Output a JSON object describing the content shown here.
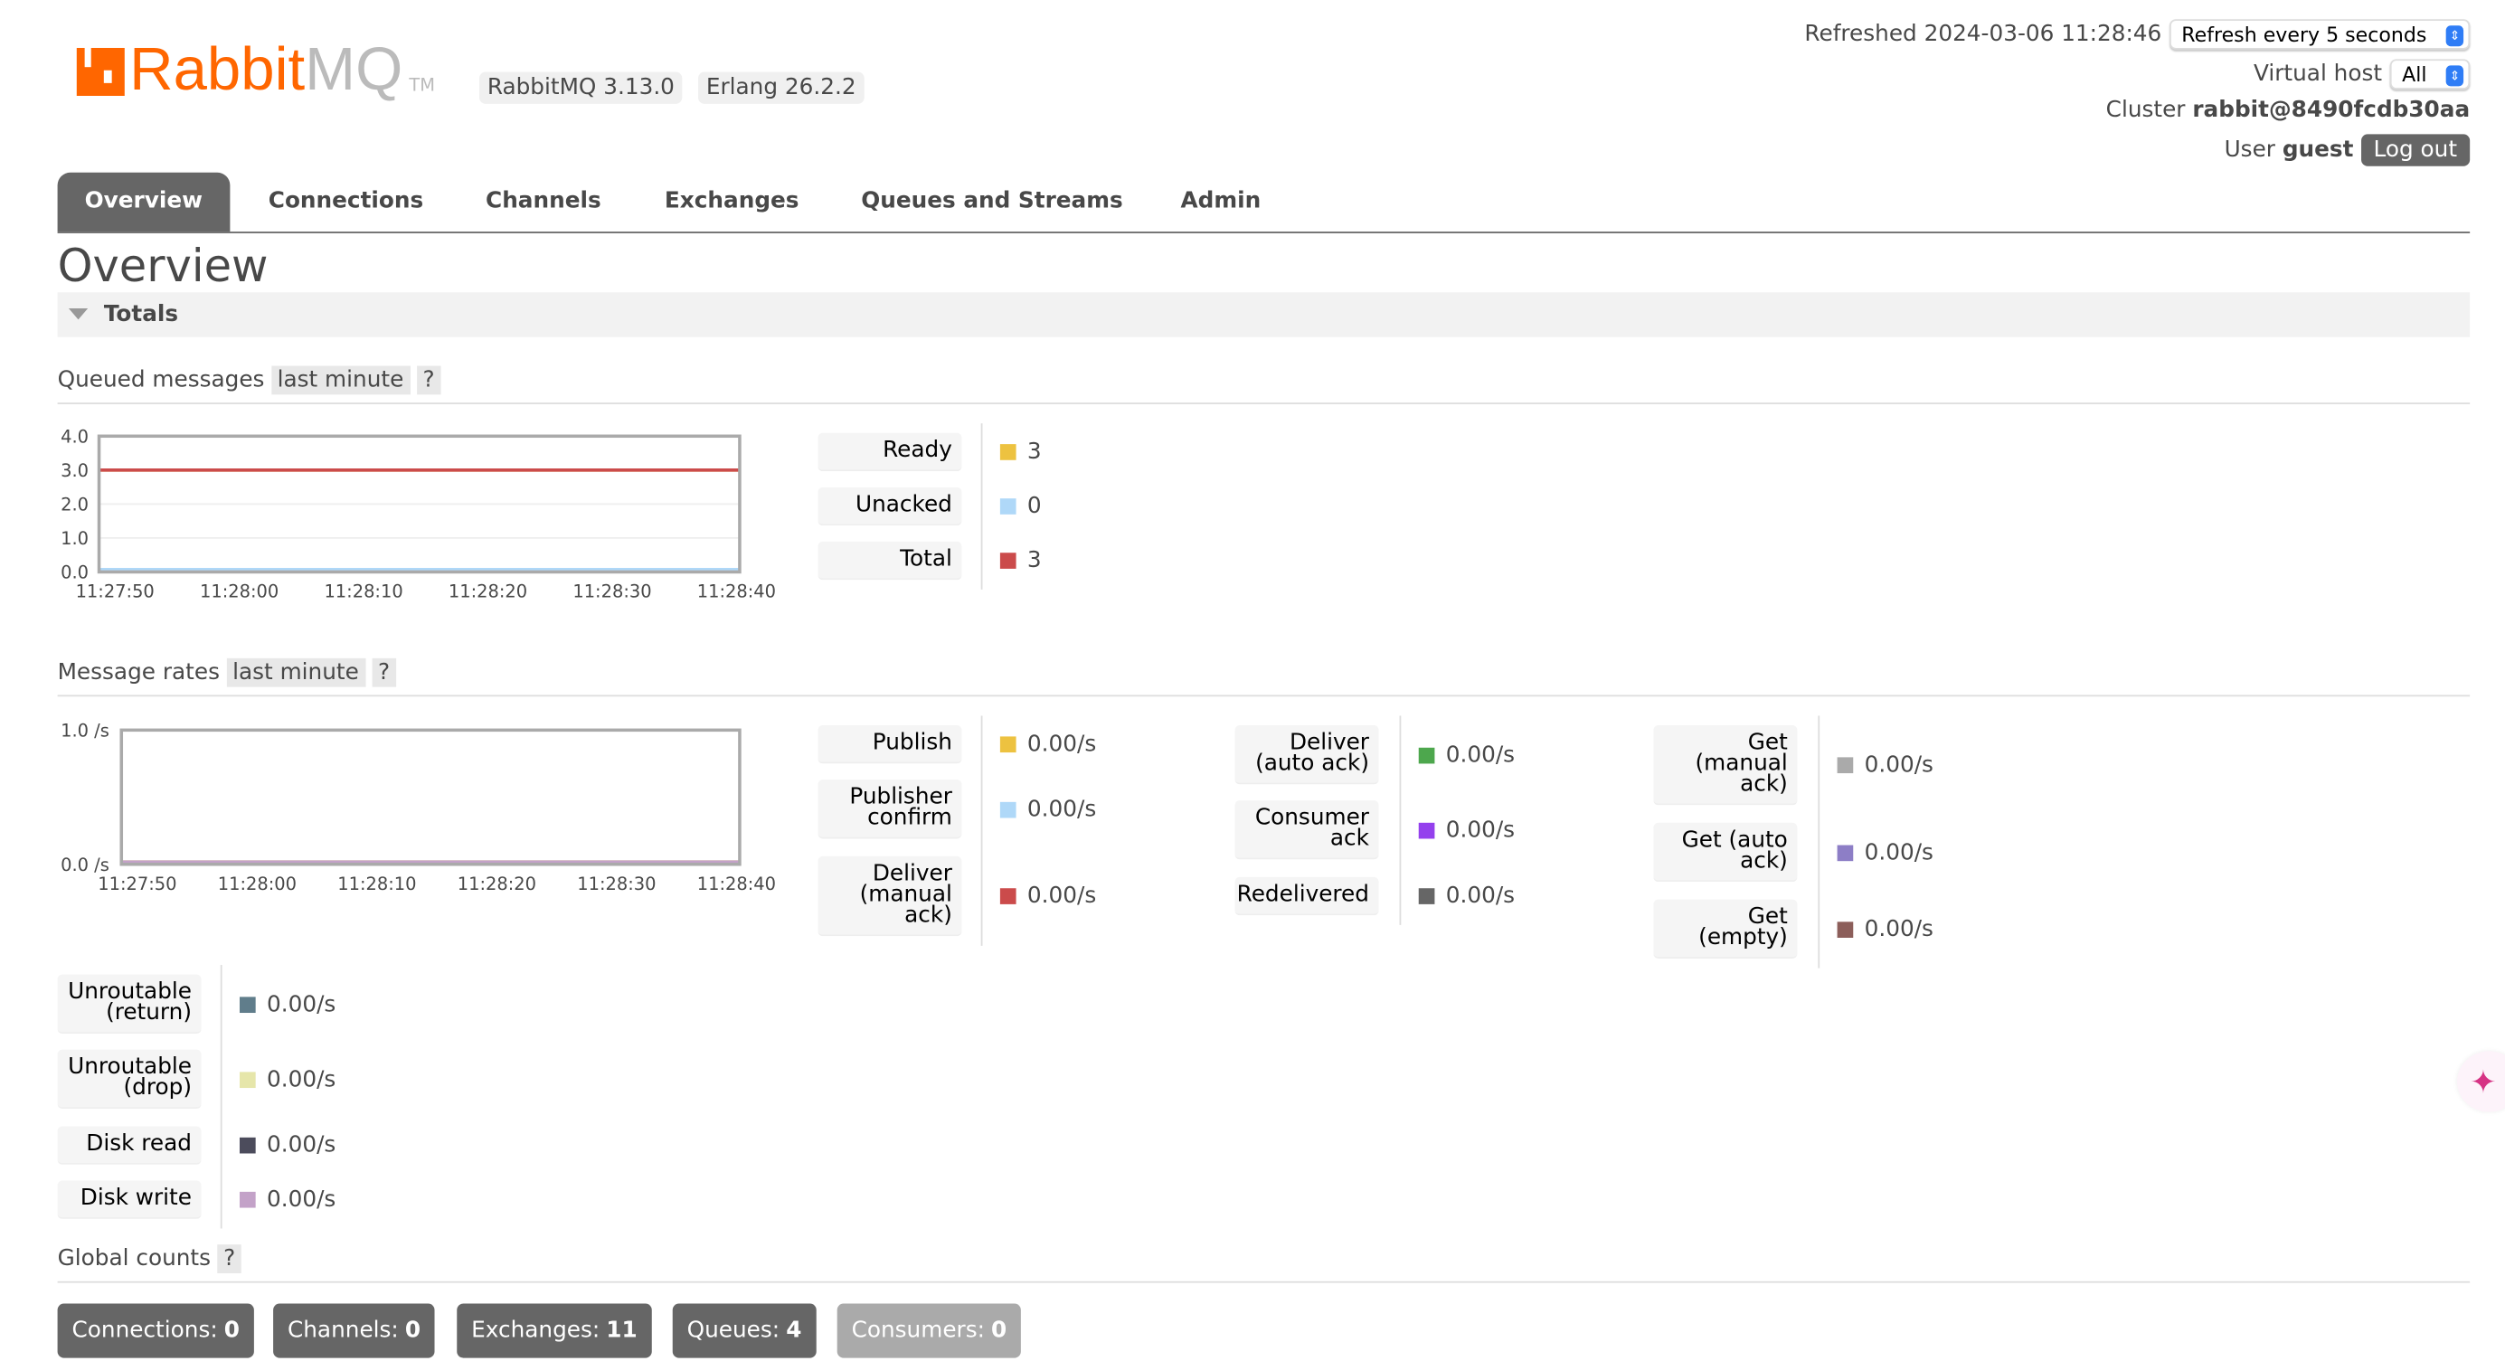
{
  "header": {
    "logo_text_a": "Rabbit",
    "logo_text_b": "MQ",
    "logo_tm": "TM",
    "version": "RabbitMQ 3.13.0",
    "erlang": "Erlang 26.2.2",
    "refreshed": "Refreshed 2024-03-06 11:28:46",
    "refresh_select": "Refresh every 5 seconds",
    "vhost_label": "Virtual host",
    "vhost_select": "All",
    "cluster_label": "Cluster",
    "cluster": "rabbit@8490fcdb30aa",
    "user_label": "User",
    "user": "guest",
    "logout": "Log out"
  },
  "tabs": [
    "Overview",
    "Connections",
    "Channels",
    "Exchanges",
    "Queues and Streams",
    "Admin"
  ],
  "page_title": "Overview",
  "totals_label": "Totals",
  "queued": {
    "label": "Queued messages",
    "range": "last minute",
    "help": "?",
    "legend": [
      {
        "label": "Ready",
        "value": "3",
        "color": "#edc240"
      },
      {
        "label": "Unacked",
        "value": "0",
        "color": "#afd8f8"
      },
      {
        "label": "Total",
        "value": "3",
        "color": "#cb4b4b"
      }
    ]
  },
  "rates": {
    "label": "Message rates",
    "range": "last minute",
    "help": "?",
    "col1": [
      {
        "label": "Publish",
        "value": "0.00/s",
        "color": "#edc240"
      },
      {
        "label": "Publisher confirm",
        "value": "0.00/s",
        "color": "#afd8f8"
      },
      {
        "label": "Deliver (manual ack)",
        "value": "0.00/s",
        "color": "#cb4b4b"
      }
    ],
    "col2": [
      {
        "label": "Deliver (auto ack)",
        "value": "0.00/s",
        "color": "#4da74d"
      },
      {
        "label": "Consumer ack",
        "value": "0.00/s",
        "color": "#9440ed"
      },
      {
        "label": "Redelivered",
        "value": "0.00/s",
        "color": "#666666"
      }
    ],
    "col3": [
      {
        "label": "Get (manual ack)",
        "value": "0.00/s",
        "color": "#aaaaaa"
      },
      {
        "label": "Get (auto ack)",
        "value": "0.00/s",
        "color": "#8d7ec6"
      },
      {
        "label": "Get (empty)",
        "value": "0.00/s",
        "color": "#8c5e5a"
      }
    ],
    "col4": [
      {
        "label": "Unroutable (return)",
        "value": "0.00/s",
        "color": "#607d8b"
      },
      {
        "label": "Unroutable (drop)",
        "value": "0.00/s",
        "color": "#e6e6aa"
      },
      {
        "label": "Disk read",
        "value": "0.00/s",
        "color": "#4c4c5c"
      },
      {
        "label": "Disk write",
        "value": "0.00/s",
        "color": "#c3a2c8"
      }
    ]
  },
  "global": {
    "label": "Global counts",
    "help": "?",
    "items": [
      {
        "label": "Connections:",
        "value": "0"
      },
      {
        "label": "Channels:",
        "value": "0"
      },
      {
        "label": "Exchanges:",
        "value": "11"
      },
      {
        "label": "Queues:",
        "value": "4"
      },
      {
        "label": "Consumers:",
        "value": "0"
      }
    ]
  },
  "chart_data": [
    {
      "type": "line",
      "x": [
        "11:27:50",
        "11:28:00",
        "11:28:10",
        "11:28:20",
        "11:28:30",
        "11:28:40"
      ],
      "yticks": [
        "0.0",
        "1.0",
        "2.0",
        "3.0",
        "4.0"
      ],
      "ylim": [
        0,
        4
      ],
      "grid": true,
      "series": [
        {
          "name": "Ready",
          "color": "#edc240",
          "values": [
            3,
            3,
            3,
            3,
            3,
            3
          ]
        },
        {
          "name": "Unacked",
          "color": "#afd8f8",
          "values": [
            0,
            0,
            0,
            0,
            0,
            0
          ]
        },
        {
          "name": "Total",
          "color": "#cb4b4b",
          "values": [
            3,
            3,
            3,
            3,
            3,
            3
          ]
        }
      ]
    },
    {
      "type": "line",
      "x": [
        "11:27:50",
        "11:28:00",
        "11:28:10",
        "11:28:20",
        "11:28:30",
        "11:28:40"
      ],
      "yticks": [
        "0.0 /s",
        "1.0 /s"
      ],
      "ylim": [
        0,
        1
      ],
      "grid": false,
      "series": [
        {
          "name": "Publish",
          "color": "#edc240",
          "values": [
            0,
            0,
            0,
            0,
            0,
            0
          ]
        },
        {
          "name": "Deliver (manual ack)",
          "color": "#c3a2c8",
          "values": [
            0,
            0,
            0,
            0,
            0,
            0
          ]
        }
      ]
    }
  ]
}
